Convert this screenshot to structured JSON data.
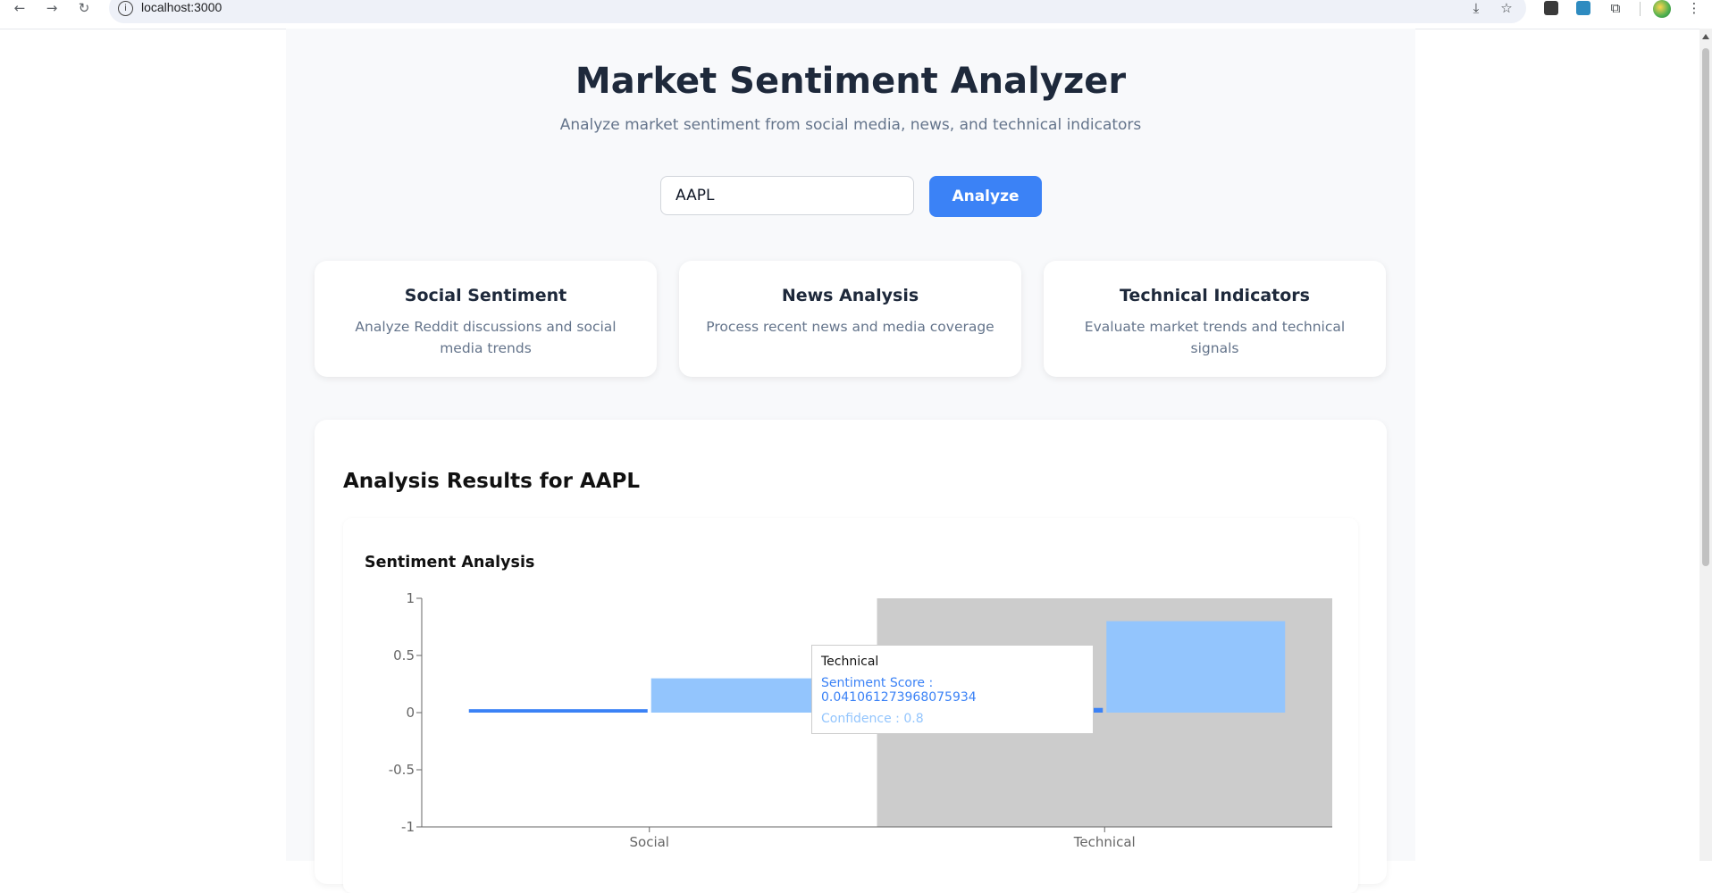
{
  "browser": {
    "url": "localhost:3000",
    "info_icon": "i"
  },
  "header": {
    "title": "Market Sentiment Analyzer",
    "subtitle": "Analyze market sentiment from social media, news, and technical indicators"
  },
  "search": {
    "value": "AAPL",
    "analyze_label": "Analyze"
  },
  "cards": [
    {
      "title": "Social Sentiment",
      "description": "Analyze Reddit discussions and social media trends"
    },
    {
      "title": "News Analysis",
      "description": "Process recent news and media coverage"
    },
    {
      "title": "Technical Indicators",
      "description": "Evaluate market trends and technical signals"
    }
  ],
  "results": {
    "title": "Analysis Results for AAPL",
    "chart_title": "Sentiment Analysis"
  },
  "tooltip": {
    "label": "Technical",
    "row1": "Sentiment Score : 0.041061273968075934",
    "row2": "Confidence : 0.8"
  },
  "colors": {
    "accent": "#3b82f6",
    "score_bar": "#3b82f6",
    "confidence_bar": "#93c5fd",
    "active_cursor": "#cccccc"
  },
  "chart_data": {
    "type": "bar",
    "categories": [
      "Social",
      "Technical"
    ],
    "series": [
      {
        "name": "Sentiment Score",
        "values": [
          0.03,
          0.041061273968075934
        ]
      },
      {
        "name": "Confidence",
        "values": [
          0.3,
          0.8
        ]
      }
    ],
    "ylim": [
      -1,
      1
    ],
    "yticks": [
      "1",
      "0.5",
      "0",
      "-0.5",
      "-1"
    ],
    "highlighted_category": "Technical"
  }
}
